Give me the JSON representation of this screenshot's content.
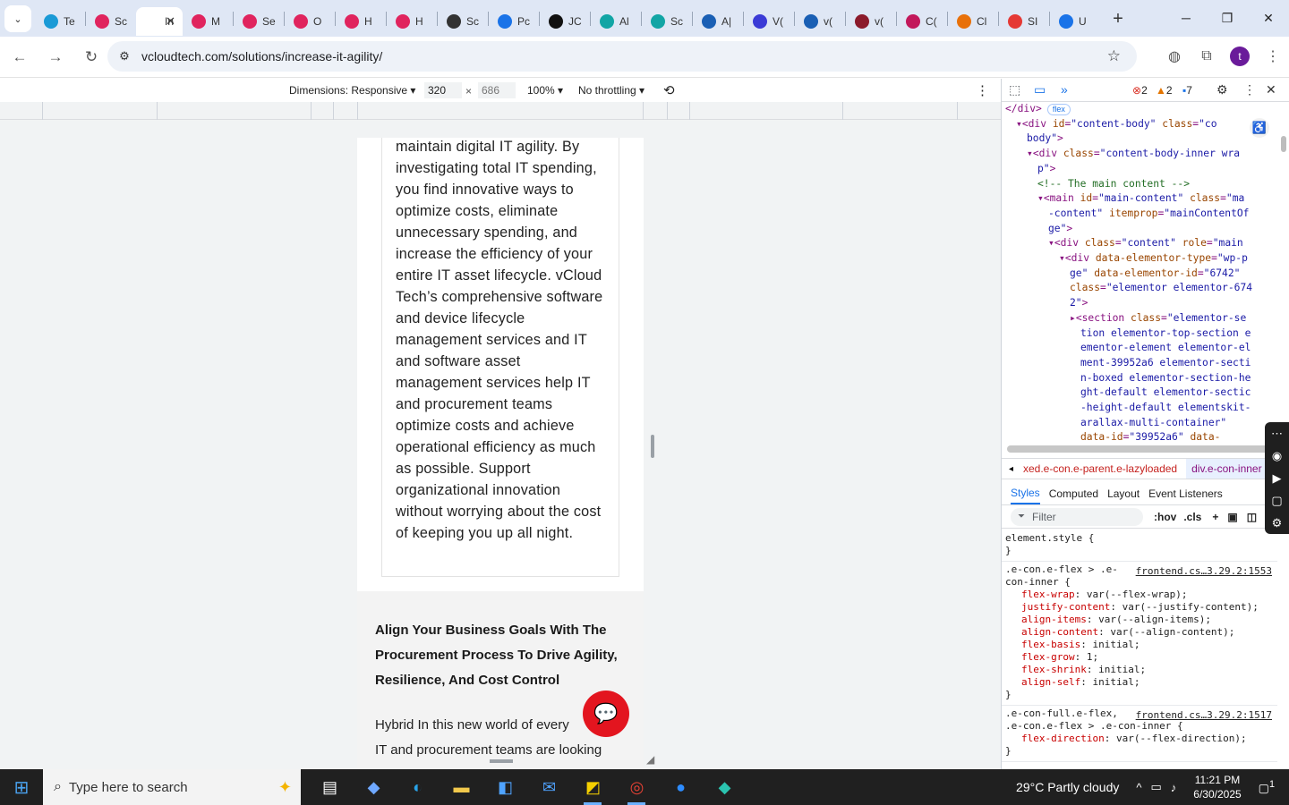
{
  "tabs": [
    {
      "title": "Te",
      "color": "#1a9ad6"
    },
    {
      "title": "Sc",
      "color": "#e0245e"
    },
    {
      "title": "In",
      "color": "#ffffff",
      "active": true
    },
    {
      "title": "M",
      "color": "#e0245e"
    },
    {
      "title": "Se",
      "color": "#e0245e"
    },
    {
      "title": "O",
      "color": "#e0245e"
    },
    {
      "title": "H",
      "color": "#e0245e"
    },
    {
      "title": "H",
      "color": "#e0245e"
    },
    {
      "title": "Sc",
      "color": "#333333"
    },
    {
      "title": "Pc",
      "color": "#1a73e8"
    },
    {
      "title": "JC",
      "color": "#111111"
    },
    {
      "title": "Al",
      "color": "#12a5a5"
    },
    {
      "title": "Sc",
      "color": "#12a5a5"
    },
    {
      "title": "A|",
      "color": "#1a5fb4"
    },
    {
      "title": "V(",
      "color": "#3b3bd6"
    },
    {
      "title": "v(",
      "color": "#1a5fb4"
    },
    {
      "title": "v(",
      "color": "#8b1a2b"
    },
    {
      "title": "C(",
      "color": "#c2185b"
    },
    {
      "title": "Cl",
      "color": "#e8710a"
    },
    {
      "title": "SI",
      "color": "#e53935"
    },
    {
      "title": "U",
      "color": "#1a73e8"
    }
  ],
  "address": {
    "url": "vcloudtech.com/solutions/increase-it-agility/"
  },
  "devtoolbar": {
    "dimensions_label": "Dimensions: Responsive ▾",
    "width": "320",
    "times": "×",
    "height": "686",
    "zoom": "100% ▾",
    "throttle": "No throttling ▾"
  },
  "page": {
    "paragraph": "maintain digital IT agility. By investigating total IT spending, you find innovative ways to optimize costs, eliminate unnecessary spending, and increase the efficiency of your entire IT asset lifecycle. vCloud Tech’s comprehensive software and device lifecycle management services and IT and software asset management services help IT and procurement teams optimize costs and achieve operational efficiency as much as possible. Support organizational innovation without worrying about the cost of keeping you up all night.",
    "heading": "Align Your Business Goals With The Procurement Process To Drive Agility, Resilience, And Cost Control",
    "body": "Hybrid In this new world of every\nIT and procurement teams are looking"
  },
  "devtools": {
    "errors": "2",
    "warnings": "2",
    "messages": "7",
    "element_lines": [
      {
        "indent": 0,
        "html": "<span class='tag'>&lt;/div&gt;</span>",
        "badge": "flex"
      },
      {
        "indent": 1,
        "html": "▾<span class='tag'>&lt;div </span><span class='attr'>id</span>=<span class='val'>\"content-body\"</span> <span class='attr'>class</span>=<span class='val'>\"co</span>"
      },
      {
        "indent": 2,
        "html": "<span class='val'>body\"</span><span class='tag'>&gt;</span>"
      },
      {
        "indent": 2,
        "html": "▾<span class='tag'>&lt;div </span><span class='attr'>class</span>=<span class='val'>\"content-body-inner wra</span>"
      },
      {
        "indent": 3,
        "html": "<span class='val'>p\"</span><span class='tag'>&gt;</span>"
      },
      {
        "indent": 3,
        "html": "<span class='cmt'>&lt;!-- The main content --&gt;</span>"
      },
      {
        "indent": 3,
        "html": "▾<span class='tag'>&lt;main </span><span class='attr'>id</span>=<span class='val'>\"main-content\"</span> <span class='attr'>class</span>=<span class='val'>\"ma</span>"
      },
      {
        "indent": 4,
        "html": "<span class='val'>-content\"</span> <span class='attr'>itemprop</span>=<span class='val'>\"mainContentOf</span>"
      },
      {
        "indent": 4,
        "html": "<span class='val'>ge\"</span><span class='tag'>&gt;</span>"
      },
      {
        "indent": 4,
        "html": "▾<span class='tag'>&lt;div </span><span class='attr'>class</span>=<span class='val'>\"content\"</span> <span class='attr'>role</span>=<span class='val'>\"main</span>"
      },
      {
        "indent": 5,
        "html": "▾<span class='tag'>&lt;div </span><span class='attr'>data-elementor-type</span>=<span class='val'>\"wp-p</span>"
      },
      {
        "indent": 6,
        "html": "<span class='val'>ge\"</span> <span class='attr'>data-elementor-id</span>=<span class='val'>\"6742\"</span>"
      },
      {
        "indent": 6,
        "html": "<span class='attr'>class</span>=<span class='val'>\"elementor elementor-674</span>"
      },
      {
        "indent": 6,
        "html": "<span class='val'>2\"</span><span class='tag'>&gt;</span>"
      },
      {
        "indent": 6,
        "html": "▸<span class='tag'>&lt;section </span><span class='attr'>class</span>=<span class='val'>\"elementor-se</span>"
      },
      {
        "indent": 7,
        "html": "<span class='val'>tion elementor-top-section e</span>"
      },
      {
        "indent": 7,
        "html": "<span class='val'>ementor-element elementor-el</span>"
      },
      {
        "indent": 7,
        "html": "<span class='val'>ment-39952a6 elementor-secti</span>"
      },
      {
        "indent": 7,
        "html": "<span class='val'>n-boxed elementor-section-he</span>"
      },
      {
        "indent": 7,
        "html": "<span class='val'>ght-default elementor-sectic</span>"
      },
      {
        "indent": 7,
        "html": "<span class='val'>-height-default elementskit-</span>"
      },
      {
        "indent": 7,
        "html": "<span class='val'>arallax-multi-container\"</span>"
      },
      {
        "indent": 7,
        "html": "<span class='attr'>data-id</span>=<span class='val'>\"39952a6\"</span> <span class='attr'>data-</span>"
      }
    ],
    "crumb1": "xed.e-con.e-parent.e-lazyloaded",
    "crumb2": "div.e-con-inner",
    "subtabs": [
      "Styles",
      "Computed",
      "Layout",
      "Event Listeners"
    ],
    "filter": "Filter",
    "hov": ":hov",
    "cls": ".cls",
    "rules": [
      {
        "selector": "element.style {",
        "source": "",
        "props": [],
        "close": "}"
      },
      {
        "selector": ".e-con.e-flex > .e-\ncon-inner {",
        "source": "frontend.cs…3.29.2:1553",
        "props": [
          [
            "flex-wrap",
            "var(--flex-wrap);"
          ],
          [
            "justify-content",
            "var(--justify-content);"
          ],
          [
            "align-items",
            "var(--align-items);"
          ],
          [
            "align-content",
            "var(--align-content);"
          ],
          [
            "flex-basis",
            "initial;"
          ],
          [
            "flex-grow",
            "1;"
          ],
          [
            "flex-shrink",
            "initial;"
          ],
          [
            "align-self",
            "initial;"
          ]
        ],
        "close": "}"
      },
      {
        "selector": ".e-con-full.e-flex,\n.e-con.e-flex > .e-con-inner {",
        "source": "frontend.cs…3.29.2:1517",
        "props": [
          [
            "flex-direction",
            "var(--flex-direction);"
          ]
        ],
        "close": "}"
      }
    ]
  },
  "taskbar": {
    "search_placeholder": "Type here to search",
    "weather": "29°C  Partly cloudy",
    "time": "11:21 PM",
    "date": "6/30/2025",
    "notif": "1"
  }
}
